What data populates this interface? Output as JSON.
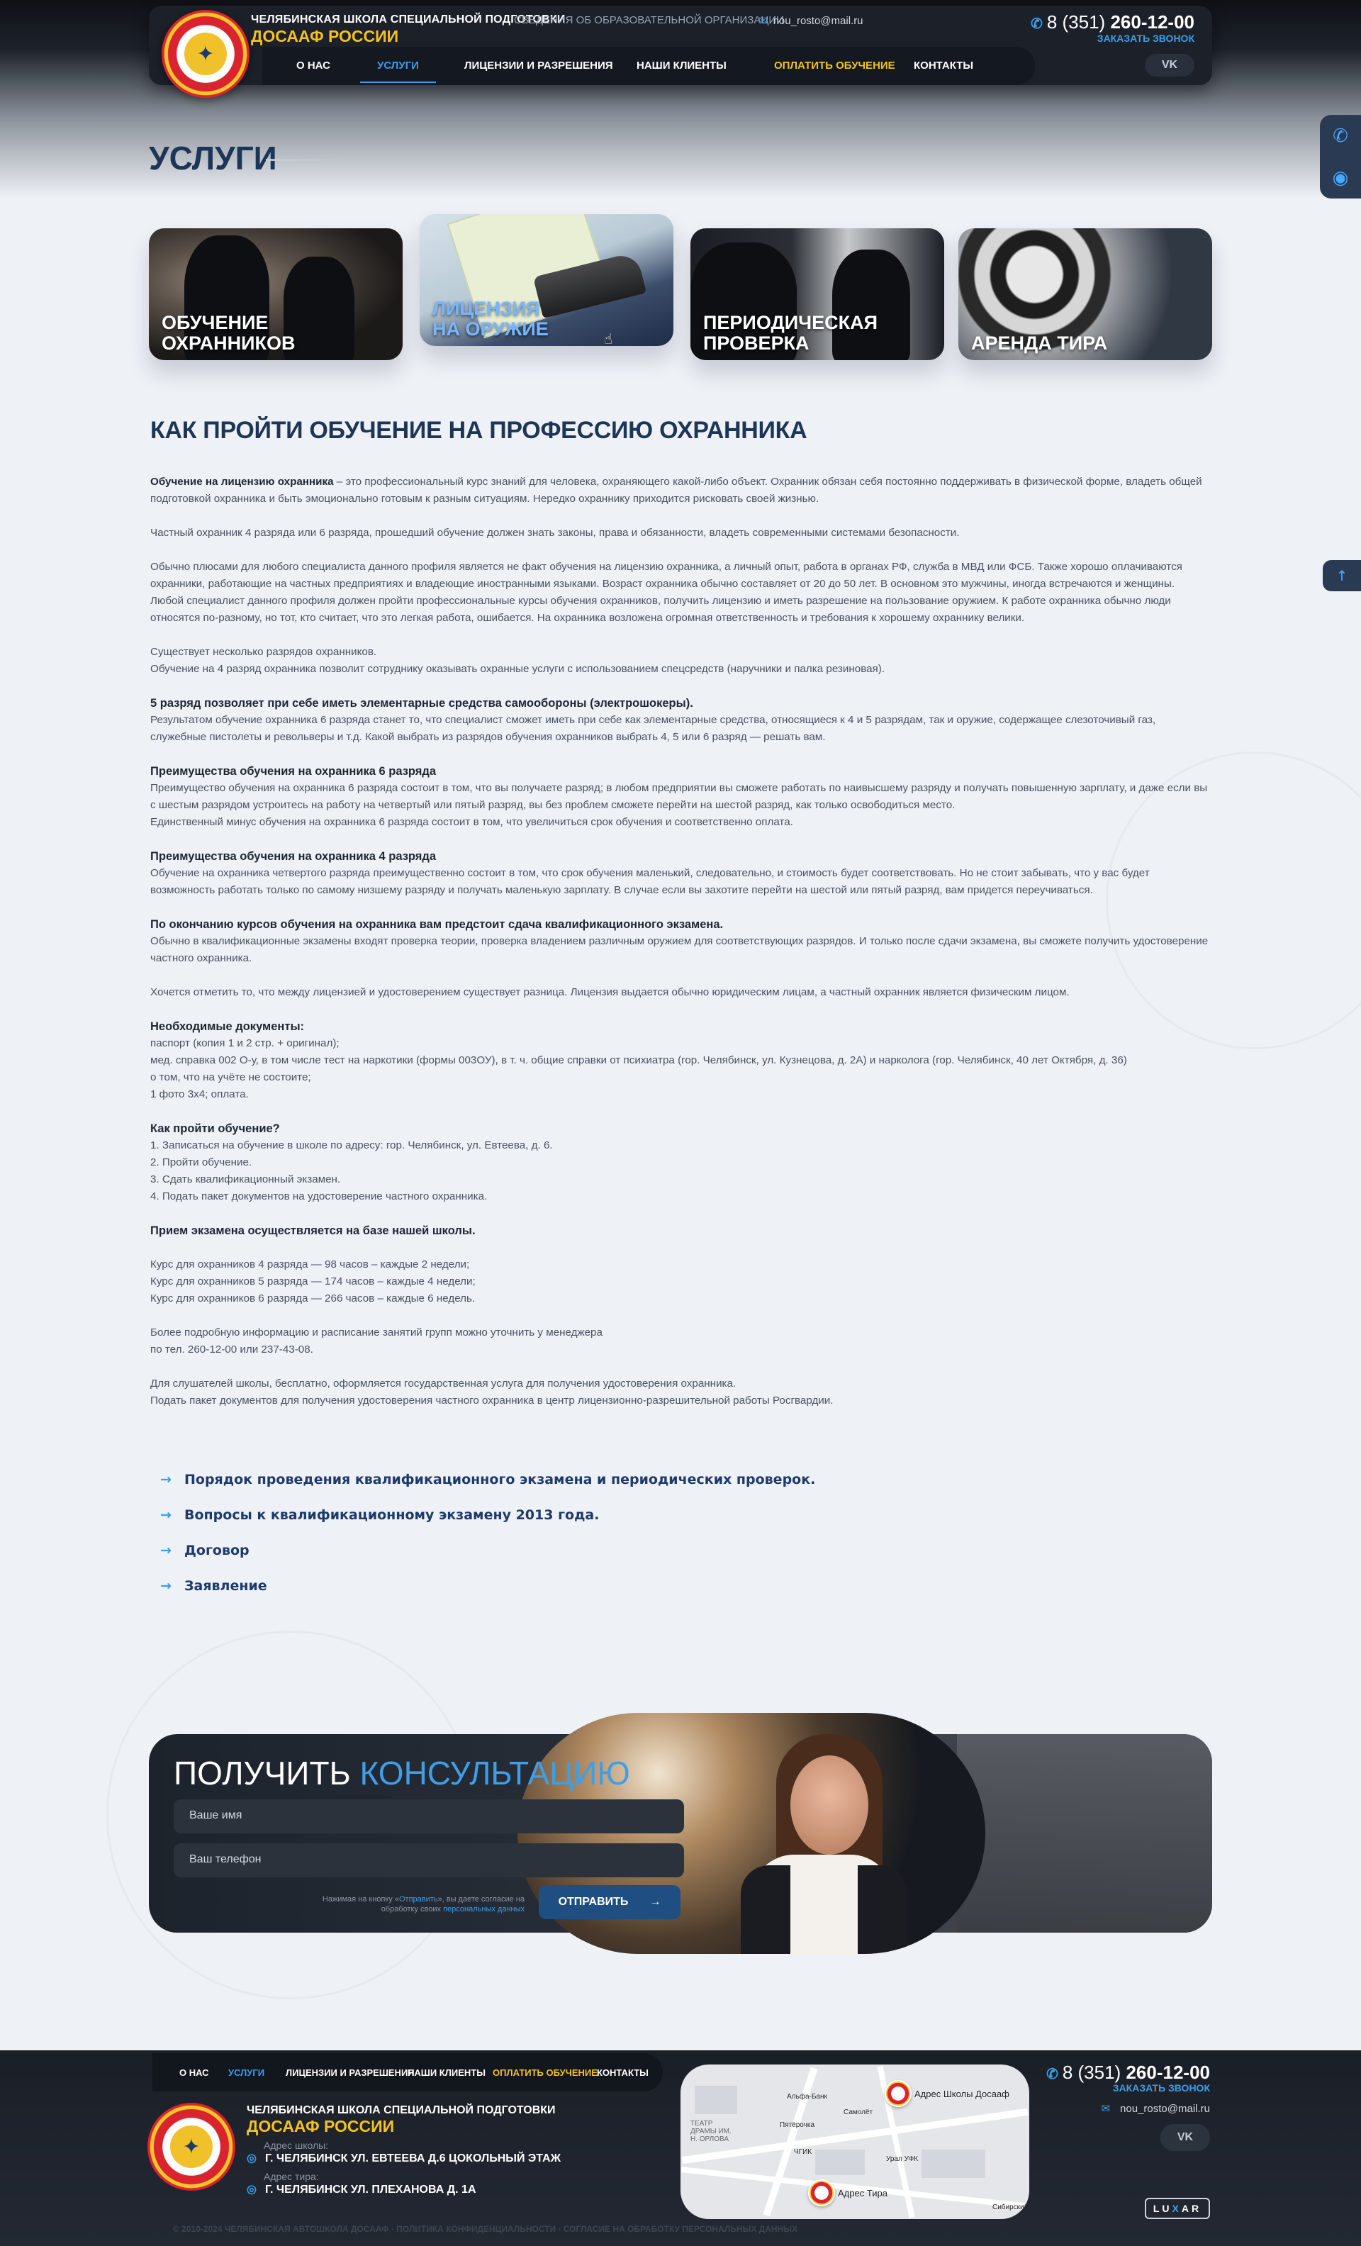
{
  "header": {
    "school_line1": "ЧЕЛЯБИНСКАЯ ШКОЛА СПЕЦИАЛЬНОЙ ПОДГОТОВКИ",
    "school_line2": "ДОСААФ РОССИИ",
    "edu_info_link": "СВЕДЕНИЯ ОБ ОБРАЗОВАТЕЛЬНОЙ ОРГАНИЗАЦИИ",
    "email": "nou_rosto@mail.ru",
    "phone_code": "8 (351)",
    "phone_number": "260-12-00",
    "callback": "ЗАКАЗАТЬ ЗВОНОК",
    "vk": "VK",
    "nav": [
      {
        "label": "О НАС"
      },
      {
        "label": "УСЛУГИ"
      },
      {
        "label": "ЛИЦЕНЗИИ И РАЗРЕШЕНИЯ"
      },
      {
        "label": "НАШИ КЛИЕНТЫ"
      },
      {
        "label": "ОПЛАТИТЬ ОБУЧЕНИЕ"
      },
      {
        "label": "КОНТАКТЫ"
      }
    ]
  },
  "side_widget": {
    "phone_icon": "phone-icon",
    "eye_icon": "eye-icon",
    "up_icon": "arrow-up-icon"
  },
  "page_title": "УСЛУГИ",
  "services": [
    {
      "label": "ОБУЧЕНИЕ ОХРАННИКОВ"
    },
    {
      "label_line1": "ЛИЦЕНЗИЯ",
      "label_line2": "НА ОРУЖИЕ"
    },
    {
      "label": "ПЕРИОДИЧЕСКАЯ ПРОВЕРКА"
    },
    {
      "label": "АРЕНДА ТИРА"
    }
  ],
  "article": {
    "title": "КАК ПРОЙТИ ОБУЧЕНИЕ НА ПРОФЕССИЮ ОХРАННИКА",
    "p1_bold": "Обучение на лицензию охранника",
    "p1_rest": " – это профессиональный курс знаний для человека, охраняющего какой-либо объект. Охранник обязан себя постоянно поддерживать в физической форме, владеть общей подготовкой охранника и быть эмоционально готовым к разным ситуациям. Нередко охраннику приходится рисковать своей жизнью.",
    "p2": "Частный охранник 4 разряда или 6 разряда, прошедший обучение должен знать законы, права и обязанности, владеть современными системами безопасности.",
    "p3": "Обычно плюсами для любого специалиста данного профиля является не факт обучения на лицензию охранника, а личный опыт, работа в органах РФ, служба в МВД или ФСБ. Также хорошо оплачиваются охранники, работающие на частных предприятиях и владеющие иностранными языками. Возраст охранника обычно составляет от 20 до 50 лет. В основном это мужчины, иногда встречаются и женщины. Любой специалист данного профиля должен пройти профессиональные курсы обучения охранников, получить лицензию и иметь разрешение на пользование оружием. К работе охранника обычно люди относятся по-разному, но тот, кто считает, что это легкая работа, ошибается. На охранника возложена огромная ответственность и требования к хорошему охраннику велики.",
    "p4a": "Существует несколько разрядов охранников.",
    "p4b": "Обучение на 4 разряд охранника позволит сотруднику оказывать охранные услуги с использованием спецсредств (наручники и палка резиновая).",
    "h5": "5 разряд позволяет при себе иметь элементарные средства самообороны (электрошокеры).",
    "p5": "Результатом обучение охранника 6 разряда станет то, что специалист сможет иметь при себе как элементарные средства, относящиеся к 4 и 5 разрядам, так и оружие, содержащее слезоточивый газ, служебные пистолеты и револьверы и т.д. Какой выбрать из разрядов обучения охранников выбрать 4, 5 или 6 разряд — решать вам.",
    "h6": "Преимущества обучения на охранника 6 разряда",
    "p6a": "Преимущество обучения на охранника 6 разряда состоит в том, что вы получаете разряд; в любом предприятии вы сможете работать по наивысшему разряду и получать повышенную зарплату, и даже если вы с шестым разрядом устроитесь на работу на четвертый или пятый разряд, вы без проблем сможете перейти на шестой разряд, как только освободиться место.",
    "p6b": "Единственный минус обучения на охранника 6 разряда состоит в том, что увеличиться срок обучения и соответственно оплата.",
    "h7": "Преимущества обучения на охранника 4 разряда",
    "p7": "Обучение на охранника четвертого разряда преимущественно состоит в том, что срок обучения маленький, следовательно, и стоимость будет соответствовать. Но не стоит забывать, что у вас будет возможность работать только по самому низшему разряду и получать маленькую зарплату. В случае если вы захотите перейти на шестой или пятый разряд, вам придется переучиваться.",
    "h8": "По окончанию курсов обучения на охранника вам предстоит сдача квалификационного экзамена.",
    "p8": "Обычно в квалификационные экзамены входят проверка теории, проверка владением различным оружием для соответствующих разрядов. И только после сдачи экзамена, вы сможете получить удостоверение частного охранника.",
    "p9": "Хочется отметить то, что между лицензией и удостоверением существует разница. Лицензия выдается обычно юридическим лицам, а частный охранник является физическим лицом.",
    "h10": "Необходимые документы:",
    "docs": [
      "паспорт (копия 1 и 2 стр. + оригинал);",
      "мед. справка 002 О-у, в том числе тест на наркотики (формы 003ОУ), в т. ч. общие справки от психиатра (гор. Челябинск, ул. Кузнецова, д. 2А) и нарколога (гор. Челябинск, 40 лет Октября, д. 36)",
      "о том, что на учёте не состоите;",
      "1 фото 3х4; оплата."
    ],
    "h11": "Как пройти обучение?",
    "steps": [
      "1. Записаться на обучение в школе по адресу: гор. Челябинск, ул. Евтеева, д. 6.",
      "2. Пройти обучение.",
      "3. Сдать квалификационный экзамен.",
      "4. Подать пакет документов на удостоверение частного охранника."
    ],
    "h12": "Прием экзамена осуществляется на базе нашей школы.",
    "courses": [
      "Курс для охранников 4 разряда — 98 часов – каждые 2 недели;",
      "Курс для охранников 5 разряда — 174 часов – каждые 4 недели;",
      "Курс для охранников 6 разряда — 266 часов – каждые 6 недель."
    ],
    "p13a": "Более подробную информацию и расписание занятий групп можно уточнить у менеджера",
    "p13b": "по тел. 260-12-00 или 237-43-08.",
    "p14a": "Для слушателей школы, бесплатно, оформляется государственная услуга для получения удостоверения охранника.",
    "p14b": "Подать пакет документов для получения удостоверения частного охранника в центр лицензионно-разрешительной работы Росгвардии."
  },
  "doc_links": [
    {
      "label": "Порядок проведения квалификационного экзамена и периодических проверок."
    },
    {
      "label": "Вопросы к квалификационному экзамену 2013 года."
    },
    {
      "label": "Договор"
    },
    {
      "label": "Заявление"
    }
  ],
  "consult": {
    "title_plain": "ПОЛУЧИТЬ",
    "title_highlight": "КОНСУЛЬТАЦИЮ",
    "name_placeholder": "Ваше имя",
    "phone_placeholder": "Ваш телефон",
    "consent_pre": "Нажимая на кнопку «",
    "consent_link": "Отправить",
    "consent_mid": "», вы даете согласие на обработку своих",
    "consent_link2": "персональных данных",
    "send": "ОТПРАВИТЬ"
  },
  "footer": {
    "nav": [
      {
        "label": "О НАС"
      },
      {
        "label": "УСЛУГИ"
      },
      {
        "label": "ЛИЦЕНЗИИ И РАЗРЕШЕНИЯ"
      },
      {
        "label": "НАШИ КЛИЕНТЫ"
      },
      {
        "label": "ОПЛАТИТЬ ОБУЧЕНИЕ"
      },
      {
        "label": "КОНТАКТЫ"
      }
    ],
    "school_line1": "ЧЕЛЯБИНСКАЯ ШКОЛА СПЕЦИАЛЬНОЙ ПОДГОТОВКИ",
    "school_line2": "ДОСААФ РОССИИ",
    "school_addr_label": "Адрес школы:",
    "school_addr_city": "Г. ЧЕЛЯБИНСК",
    "school_addr": "УЛ. ЕВТЕЕВА Д.6 ЦОКОЛЬНЫЙ ЭТАЖ",
    "range_addr_label": "Адрес тира:",
    "range_addr_city": "Г. ЧЕЛЯБИНСК",
    "range_addr": "УЛ. ПЛЕХАНОВА Д. 1А",
    "map": {
      "school_marker": "Адрес Школы Досааф",
      "range_marker": "Адрес Тира",
      "poi": [
        "Альфа-Банк",
        "Самолёт",
        "Пятёрочка",
        "ЧГИК",
        "Урал УФК",
        "ТЕАТР ДРАМЫ ИМ. Н. ОРЛОВА",
        "Сибирский"
      ]
    },
    "phone_code": "8 (351)",
    "phone_number": "260-12-00",
    "callback": "ЗАКАЗАТЬ ЗВОНОК",
    "email": "nou_rosto@mail.ru",
    "vk": "VK",
    "luxar_pre": "LU",
    "luxar_x": "X",
    "luxar_post": "AR",
    "copyright": "© 2010-2024 ЧЕЛЯБИНСКАЯ АВТОШКОЛА ДОСААФ · ПОЛИТИКА КОНФИДЕНЦИАЛЬНОСТИ · СОГЛАСИЕ НА ОБРАБОТКУ ПЕРСОНАЛЬНЫХ ДАННЫХ"
  },
  "colors": {
    "accent": "#3e9ee8",
    "brand_yellow": "#f4c21f",
    "dark": "#1b2029",
    "title": "#1d3557"
  }
}
